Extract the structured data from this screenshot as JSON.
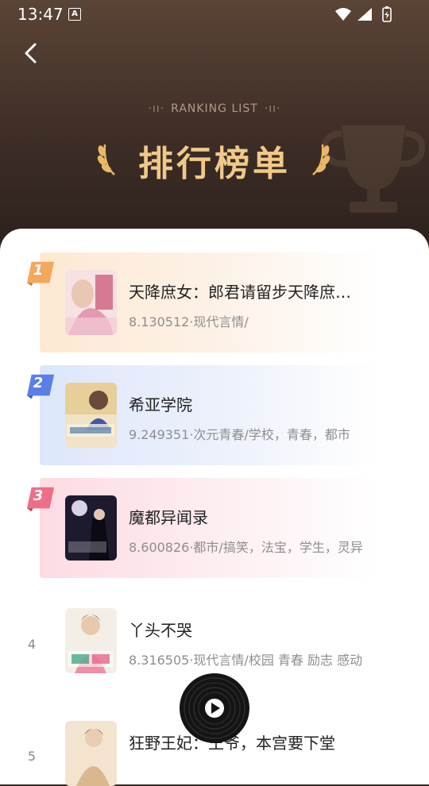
{
  "status": {
    "time": "13:47",
    "a_label": "A"
  },
  "header": {
    "subtitle": "RANKING LIST",
    "title": "排行榜单"
  },
  "ranks": [
    {
      "rank": "1",
      "title": "天降庶女：郎君请留步天降庶女：郎君请留步",
      "meta": "8.130512·现代言情/"
    },
    {
      "rank": "2",
      "title": "希亚学院",
      "meta": "9.249351·次元青春/学校，青春，都市"
    },
    {
      "rank": "3",
      "title": "魔都异闻录",
      "meta": "8.600826·都市/搞笑，法宝，学生，灵异"
    },
    {
      "rank": "4",
      "title": "丫头不哭",
      "meta": "8.316505·现代言情/校园 青春 励志 感动"
    },
    {
      "rank": "5",
      "title": "狂野王妃：王爷，本宫要下堂"
    }
  ],
  "colors": {
    "title_gold": "#f0c98a",
    "badge_1": "#f4a85e",
    "badge_2": "#5b7fe6",
    "badge_3": "#ee6e86"
  }
}
